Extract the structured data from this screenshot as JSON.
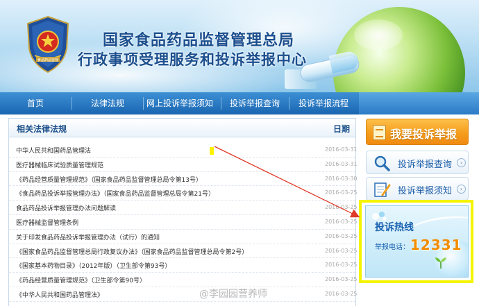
{
  "header": {
    "title_line1": "国家食品药品监督管理总局",
    "title_line2": "行政事项受理服务和投诉举报中心",
    "emblem_text": "食品药品监督"
  },
  "nav": {
    "items": [
      {
        "label": "首页"
      },
      {
        "label": "法律法规"
      },
      {
        "label": "网上投诉举报须知"
      },
      {
        "label": "投诉举报查询"
      },
      {
        "label": "投诉举报流程"
      }
    ]
  },
  "laws_panel": {
    "title": "相关法律法规",
    "date_header": "日期",
    "rows": [
      {
        "title": "中华人民共和国药品管理法",
        "date": "2016-03-31"
      },
      {
        "title": "医疗器械临床试验质量管理规范",
        "date": "2016-03-31"
      },
      {
        "title": "《药品经营质量管理规范》（国家食品药品监督管理总局令第13号）",
        "date": "2016-03-30"
      },
      {
        "title": "《食品药品投诉举报管理办法》（国家食品药品监督管理总局令第21号）",
        "date": "2016-03-25"
      },
      {
        "title": "食品药品投诉举报管理办法问题解读",
        "date": "2016-03-25"
      },
      {
        "title": "医疗器械监督管理条例",
        "date": "2016-03-25"
      },
      {
        "title": "关于印发食品药品投诉举报管理办法（试行）的通知",
        "date": "2016-03-25"
      },
      {
        "title": "《国家食品药品监督管理总局行政复议办法》（国家食品药品监督管理总局令第2号）",
        "date": "2016-03-25"
      },
      {
        "title": "《国家基本药物目录》（2012年版）（卫生部令第93号）",
        "date": "2016-03-25"
      },
      {
        "title": "《药品经营质量管理规范》（卫生部令第90号）",
        "date": "2016-03-25"
      },
      {
        "title": "《中华人民共和国药品管理法》",
        "date": "2016-03-25"
      }
    ]
  },
  "sidebar": {
    "report_button": "我要投诉举报",
    "query_link": "投诉举报查询",
    "notice_link": "投诉举报须知",
    "arrow_glyph": "›"
  },
  "hotline": {
    "title": "投诉热线",
    "label": "举报电话：",
    "number": "12331"
  },
  "watermark": "@李园园营养师",
  "colors": {
    "nav_blue": "#1a66b1",
    "title_blue": "#1c4f8e",
    "report_orange": "#f59d1c",
    "hotline_number": "#f28c00",
    "highlight_yellow": "#f4f400",
    "arrow_red": "#e03a2a"
  }
}
